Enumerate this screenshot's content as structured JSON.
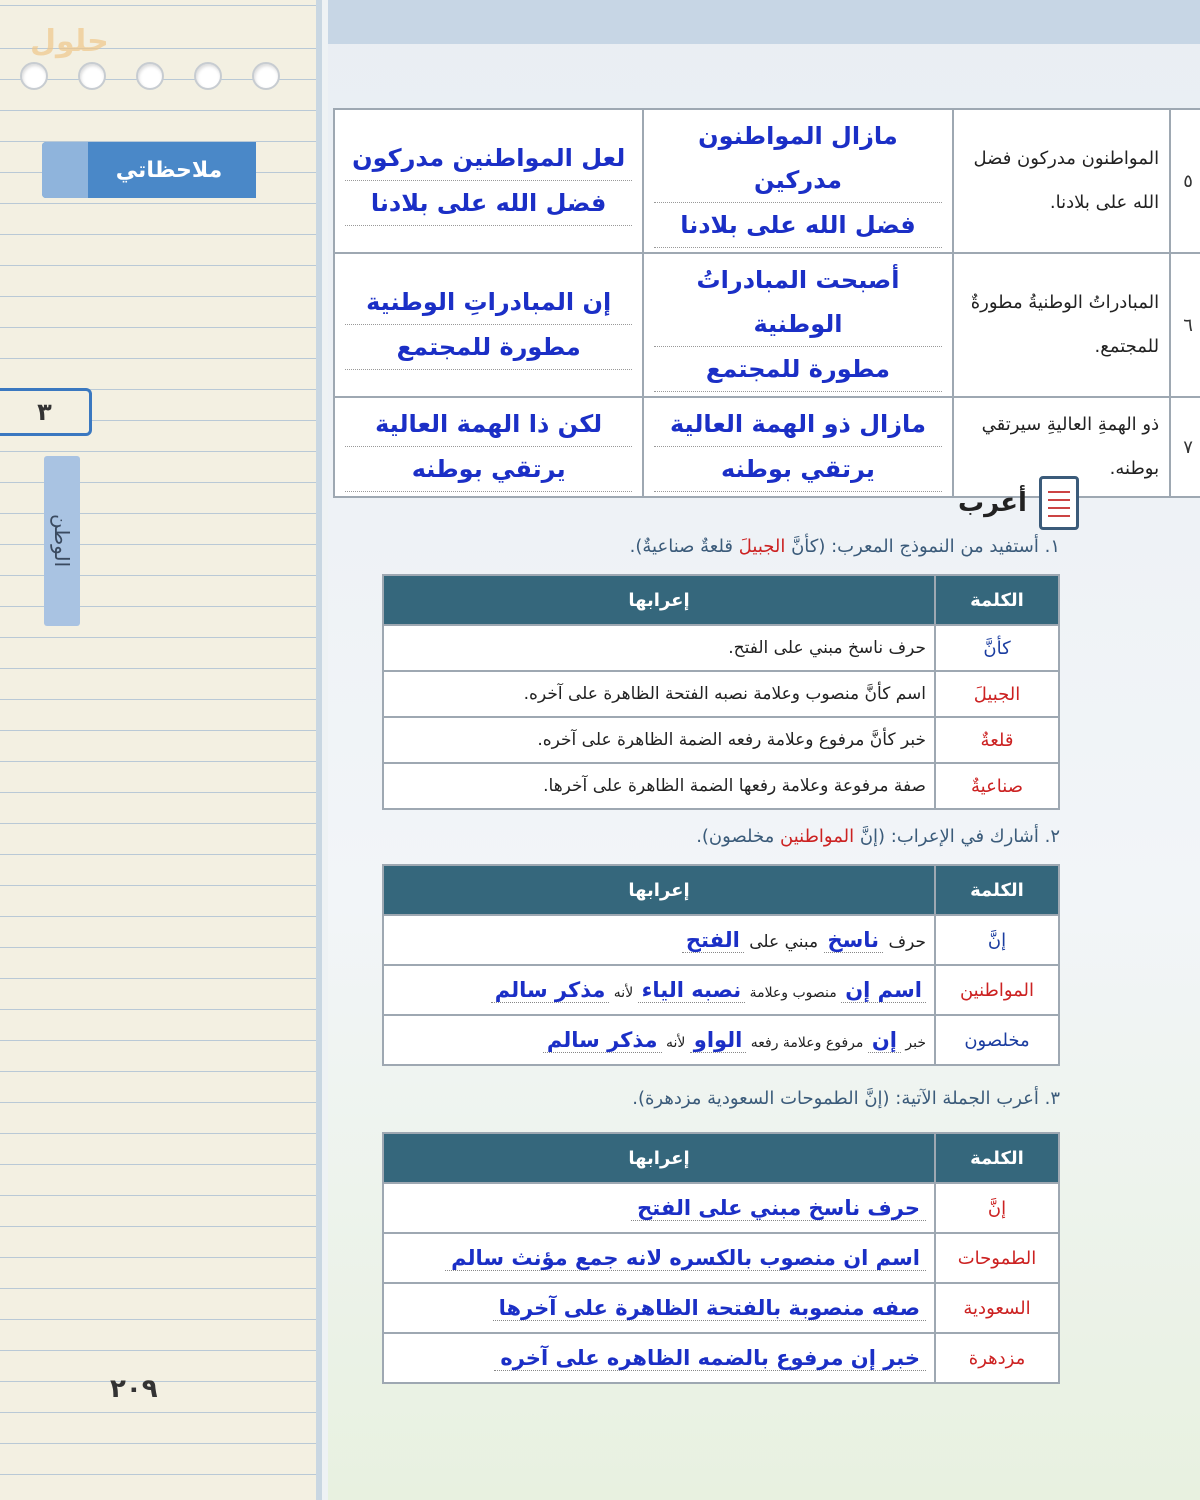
{
  "sidebar": {
    "brand": "حلول",
    "notes_title": "ملاحظاتي",
    "unit_number": "٣",
    "unit_label": "الوطن",
    "page_number": "٢٠٩"
  },
  "sentences": [
    {
      "num": "٥",
      "original": "المواطنون مدركون فضل الله على بلادنا.",
      "ans1_l1": "مازال المواطنون مدركين",
      "ans1_l2": "فضل الله على بلادنا",
      "ans2_l1": "لعل المواطنين مدركون",
      "ans2_l2": "فضل الله على بلادنا"
    },
    {
      "num": "٦",
      "original": "المبادراتُ الوطنيةُ مطورةٌ للمجتمع.",
      "ans1_l1": "أصبحت المبادراتُ الوطنية",
      "ans1_l2": "مطورة للمجتمع",
      "ans2_l1": "إن المبادراتِ الوطنية",
      "ans2_l2": "مطورة للمجتمع"
    },
    {
      "num": "٧",
      "original": "ذو الهمةِ العاليةِ سيرتقي بوطنه.",
      "ans1_l1": "مازال ذو الهمة العالية",
      "ans1_l2": "يرتقي بوطنه",
      "ans2_l1": "لكن ذا الهمة العالية",
      "ans2_l2": "يرتقي بوطنه"
    }
  ],
  "section_title": "أعرب",
  "q1": {
    "prefix": "١. أستفيد من النموذج المعرب: (كأنَّ ",
    "red": "الجبيلَ",
    "suffix": " قلعةٌ صناعيةٌ).",
    "header_word": "الكلمة",
    "header_desc": "إعرابها",
    "rows": [
      {
        "word": "كأنَّ",
        "desc": "حرف ناسخ مبني على الفتح."
      },
      {
        "word": "الجبيلَ",
        "desc": "اسم كأنَّ منصوب وعلامة نصبه الفتحة الظاهرة على آخره."
      },
      {
        "word": "قلعةٌ",
        "desc": "خبر كأنَّ مرفوع وعلامة رفعه الضمة الظاهرة على آخره."
      },
      {
        "word": "صناعيةٌ",
        "desc": "صفة مرفوعة وعلامة رفعها الضمة الظاهرة على آخرها."
      }
    ]
  },
  "q2": {
    "prefix": "٢. أشارك في الإعراب: (إنَّ ",
    "red": "المواطنين",
    "suffix": " مخلصون).",
    "header_word": "الكلمة",
    "header_desc": "إعرابها",
    "row1": {
      "word": "إنَّ",
      "t1": "حرف",
      "f1": "ناسخ",
      "t2": "مبني على",
      "f2": "الفتح"
    },
    "row2": {
      "word": "المواطنين",
      "f1": "اسم إن",
      "t1": "منصوب وعلامة",
      "f2": "نصبه الياء",
      "t2": "لأنه",
      "f3": "مذكر سالم"
    },
    "row3": {
      "word": "مخلصون",
      "t1": "خبر",
      "f1": "إن",
      "t2": "مرفوع وعلامة رفعه",
      "f2": "الواو",
      "t3": "لأنه",
      "f3": "مذكر سالم"
    }
  },
  "q3": {
    "prefix": "٣. أعرب الجملة الآتية: (إنَّ الطموحات السعودية مزدهرة).",
    "header_word": "الكلمة",
    "header_desc": "إعرابها",
    "rows": [
      {
        "word": "إنَّ",
        "desc": "حرف ناسخ مبني على الفتح"
      },
      {
        "word": "الطموحات",
        "desc": "اسم ان منصوب بالكسره لانه جمع مؤنث سالم"
      },
      {
        "word": "السعودية",
        "desc": "صفه منصوبة بالفتحة الظاهرة على آخرها"
      },
      {
        "word": "مزدهرة",
        "desc": "خبر إن مرفوع بالضمه الظاهره على آخره"
      }
    ]
  }
}
